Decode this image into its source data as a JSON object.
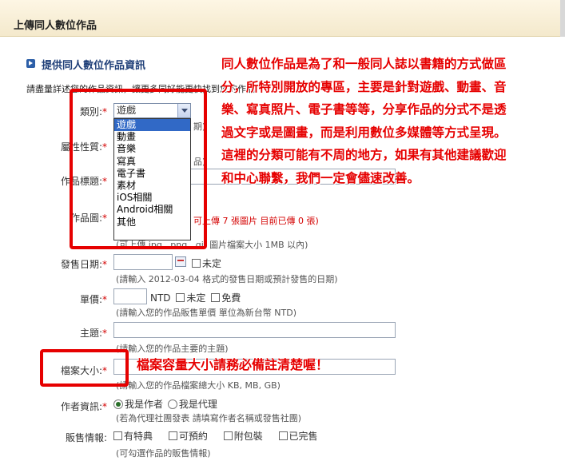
{
  "page": {
    "title": "上傳同人數位作品",
    "section_title": "提供同人數位作品資訊",
    "intro": "請盡量詳述您的作品資訊，讓更多同好能更快找到您的作品"
  },
  "form": {
    "category": {
      "label": "類別:",
      "required": "*",
      "value": "遊戲",
      "options": [
        "遊戲",
        "動畫",
        "音樂",
        "寫真",
        "電子書",
        "素材",
        "iOS相關",
        "Android相關",
        "其他"
      ]
    },
    "category_hint": "期)",
    "attribute": {
      "label": "屬性性質:",
      "required": "*",
      "hint": "品)"
    },
    "work_title": {
      "label": "作品標題:",
      "required": "*"
    },
    "work_image": {
      "label": "作品圖:",
      "required": "*",
      "upload_note": "可上傳 7 張圖片 目前已傳 0 張)",
      "hint": "(可上傳 jpg , png , gif 圖片檔案大小 1MB 以內)"
    },
    "release_date": {
      "label": "發售日期:",
      "required": "*",
      "undecided": "未定",
      "hint": "(請輸入 2012-03-04 格式的發售日期或預計發售的日期)"
    },
    "price": {
      "label": "單價:",
      "required": "*",
      "currency": "NTD",
      "undecided": "未定",
      "free": "免費",
      "hint": "(請輸入您的作品販售單價 單位為新台幣 NTD)"
    },
    "theme": {
      "label": "主題:",
      "required": "*",
      "hint": "(請輸入您的作品主要的主題)"
    },
    "file_size": {
      "label": "檔案大小:",
      "required": "*",
      "hint": "(請輸入您的作品檔案總大小 KB, MB, GB)"
    },
    "author_info": {
      "label": "作者資訊:",
      "required": "*",
      "option_author": "我是作者",
      "option_agent": "我是代理",
      "hint": "(若為代理社團發表 請填寫作者名稱或發售社團)"
    },
    "sales_info": {
      "label": "販售情報:",
      "options": [
        "有特典",
        "可預約",
        "附包裝",
        "已完售"
      ],
      "hint": "(可勾選作品的販售情報)"
    }
  },
  "annotations": {
    "category_note_lines": [
      "同人數位作品是為了和一般同人誌以書籍的方式做區",
      "分，所特別開放的專區，主要是針對遊戲、動畫、音",
      "樂、寫真照片、電子書等等，分享作品的分式不是透",
      "過文字或是圖畫，而是利用數位多媒體等方式呈現。",
      "這裡的分類可能有不周的地方，如果有其他建議歡迎",
      "和中心聯繫，我們一定會儘速改善。"
    ],
    "file_size_note": "檔案容量大小請務必備註清楚喔！",
    "color": "#e60000"
  }
}
